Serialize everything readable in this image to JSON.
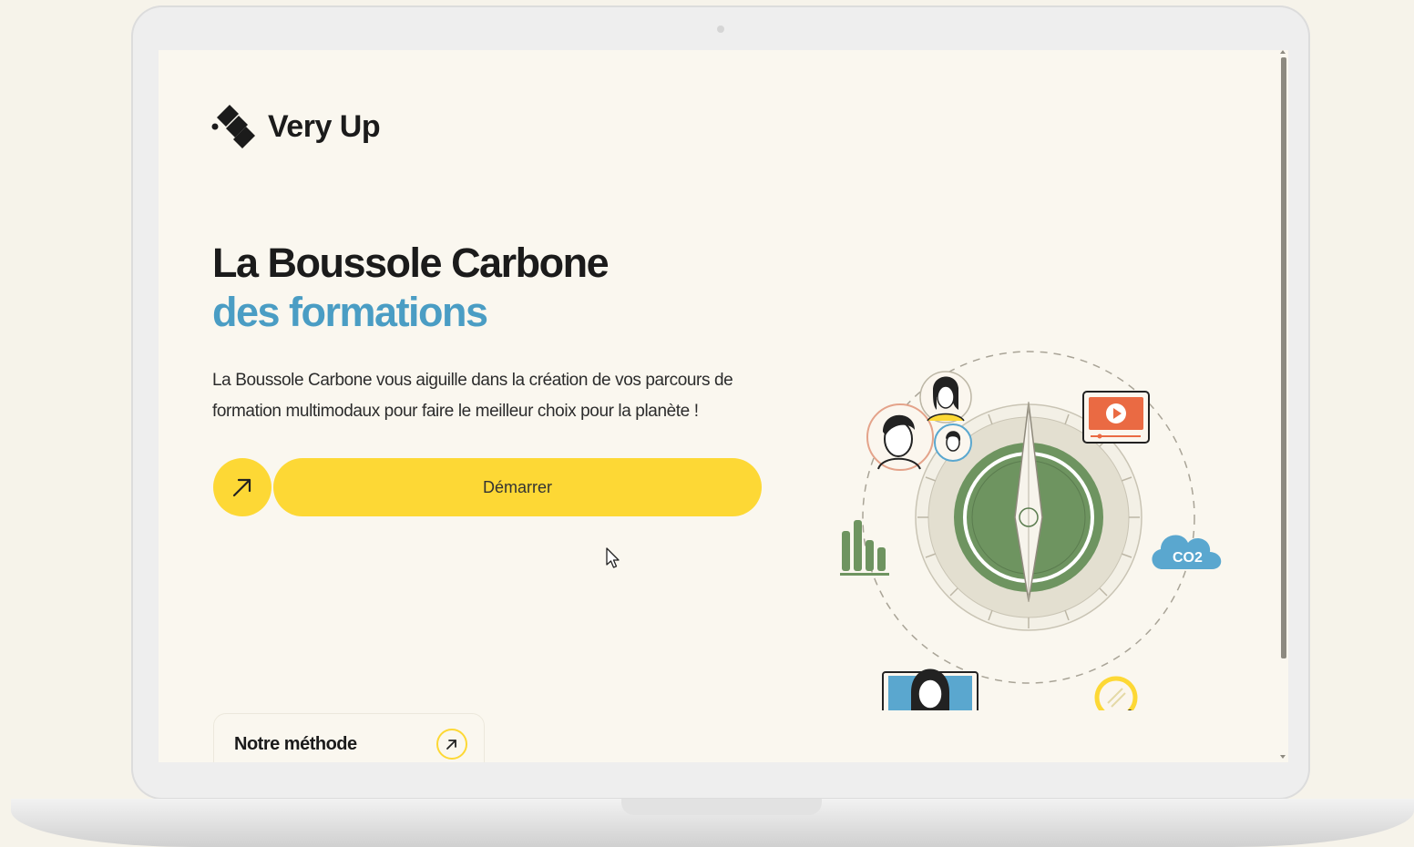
{
  "brand": {
    "name": "Very Up"
  },
  "hero": {
    "title_line1": "La Boussole Carbone",
    "title_line2": "des formations",
    "description": "La Boussole Carbone vous aiguille dans la création de vos parcours de formation multimodaux pour faire le meilleur choix pour la planète !"
  },
  "cta": {
    "label": "Démarrer",
    "icon": "arrow-up-right-icon"
  },
  "method_card": {
    "label": "Notre méthode",
    "icon": "arrow-up-right-icon"
  },
  "illustration": {
    "cloud_label": "CO2"
  },
  "colors": {
    "accent_yellow": "#fdd835",
    "title_blue": "#4a9dc4",
    "compass_green": "#6e9460",
    "cloud_blue": "#5aa7cf",
    "video_orange": "#ea6a43",
    "background": "#faf7ef"
  }
}
